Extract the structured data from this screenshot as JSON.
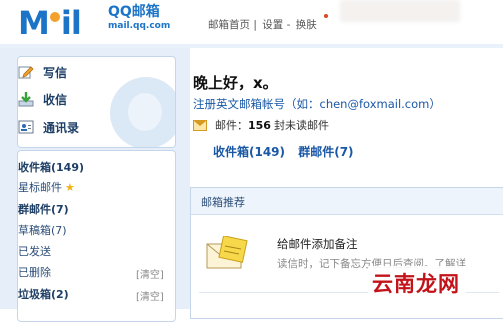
{
  "header": {
    "logo_letters": "M",
    "logo_letters_rest": "il",
    "logo_cn": "QQ邮箱",
    "logo_url": "mail.qq.com",
    "nav": [
      "邮箱首页",
      "设置",
      "换肤"
    ],
    "nav_sep": "|",
    "nav_dash": "-"
  },
  "sidebar": {
    "actions": [
      {
        "label": "写信",
        "icon": "write-icon"
      },
      {
        "label": "收信",
        "icon": "receive-icon"
      },
      {
        "label": "通讯录",
        "icon": "contacts-icon"
      }
    ],
    "folders": [
      {
        "label": "收件箱(149)",
        "bold": true
      },
      {
        "label": "星标邮件",
        "star": true
      },
      {
        "label": "群邮件(7)",
        "bold": true
      },
      {
        "label": "草稿箱(7)"
      },
      {
        "label": "已发送"
      },
      {
        "label": "已删除",
        "action": "[清空]"
      },
      {
        "label": "垃圾箱(2)",
        "bold": true,
        "action": "[清空]"
      }
    ]
  },
  "main": {
    "greeting": "晚上好，x。",
    "account_prompt": "注册英文邮箱帐号（如：chen@foxmail.com）",
    "mail_label": "邮件：",
    "mail_count": "156",
    "mail_unit": "封",
    "mail_unread": "未读邮件",
    "quick_links": [
      "收件箱(149)",
      "群邮件(7)"
    ],
    "recommend": {
      "title": "邮箱推荐",
      "item_title": "给邮件添加备注",
      "item_desc": "读信时，记下备忘方便日后查阅。了解详"
    }
  },
  "watermark": "云南龙网",
  "colors": {
    "brand": "#1c74c7",
    "link": "#1a58a6",
    "sidebar_bg": "#e6eff9",
    "watermark": "#c3131a"
  }
}
